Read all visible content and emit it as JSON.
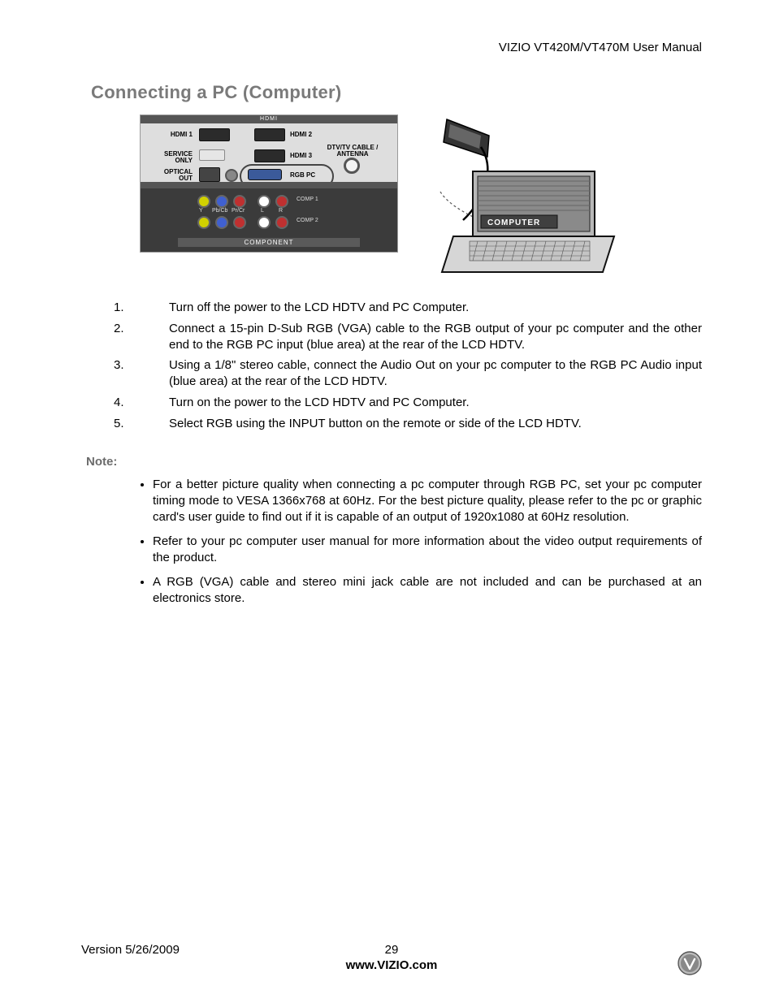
{
  "header": {
    "manual_title": "VIZIO VT420M/VT470M User Manual"
  },
  "section": {
    "title": "Connecting a PC (Computer)"
  },
  "figure": {
    "panel": {
      "top_label": "HDMI",
      "hdmi1": "HDMI 1",
      "hdmi2": "HDMI 2",
      "hdmi3": "HDMI 3",
      "service": "SERVICE ONLY",
      "optical": "OPTICAL OUT",
      "rgb": "RGB PC",
      "antenna": "DTV/TV CABLE / ANTENNA",
      "comp1": "COMP 1",
      "comp2": "COMP 2",
      "component": "COMPONENT",
      "jacks": {
        "y": "Y",
        "pbcb": "Pb/Cb",
        "prcr": "Pr/Cr",
        "l": "L",
        "r": "R"
      }
    },
    "laptop": {
      "label": "COMPUTER"
    }
  },
  "steps": [
    "Turn off the power to the LCD HDTV and PC Computer.",
    "Connect a 15-pin D-Sub RGB (VGA) cable to the RGB output of your pc computer and the other end to the RGB PC input (blue area) at the rear of the LCD HDTV.",
    "Using a 1/8\" stereo cable, connect the Audio Out on your pc computer to the RGB PC Audio input (blue area) at the rear of the LCD HDTV.",
    "Turn on the power to the LCD HDTV and PC Computer.",
    "Select RGB using the INPUT button on the remote or side of the LCD HDTV."
  ],
  "note_label": "Note:",
  "notes": [
    "For a better picture quality when connecting a pc computer through RGB PC, set your pc computer timing mode to VESA 1366x768 at 60Hz.  For the best picture quality, please refer to the pc or graphic card's user guide to find out if it is capable of an output of 1920x1080 at 60Hz resolution.",
    "Refer to your pc computer user manual for more information about the video output requirements of the product.",
    "A RGB (VGA) cable and stereo mini jack cable are not included and can be purchased at an electronics store."
  ],
  "footer": {
    "version": "Version 5/26/2009",
    "page": "29",
    "url": "www.VIZIO.com"
  }
}
